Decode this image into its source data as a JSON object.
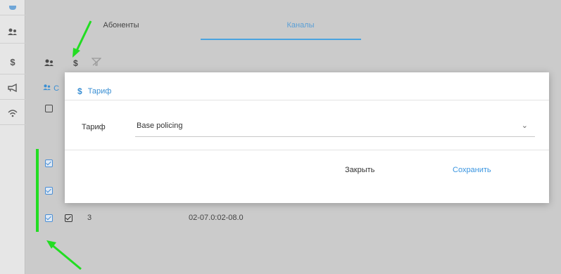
{
  "sidebar": {
    "items": [
      {
        "icon": "users-icon"
      },
      {
        "icon": "dollar-icon",
        "glyph": "$"
      },
      {
        "icon": "megaphone-icon"
      },
      {
        "icon": "wifi-icon"
      }
    ]
  },
  "tabs": [
    {
      "label": "Абоненты",
      "active": false
    },
    {
      "label": "Каналы",
      "active": true
    }
  ],
  "toolbar": {
    "tariff_glyph": "$",
    "section_glyph": "С"
  },
  "table": {
    "rows": [
      {
        "checked": true,
        "num": "",
        "channel": ""
      },
      {
        "checked": true,
        "num": "",
        "channel": ""
      },
      {
        "checked": true,
        "num": "3",
        "channel": "02-07.0:02-08.0"
      }
    ]
  },
  "modal": {
    "title_icon": "$",
    "title": "Тариф",
    "field_label": "Тариф",
    "select_value": "Base policing",
    "close_label": "Закрыть",
    "save_label": "Сохранить"
  },
  "colors": {
    "accent": "#3a8fd3",
    "annotation": "#22dd22"
  }
}
